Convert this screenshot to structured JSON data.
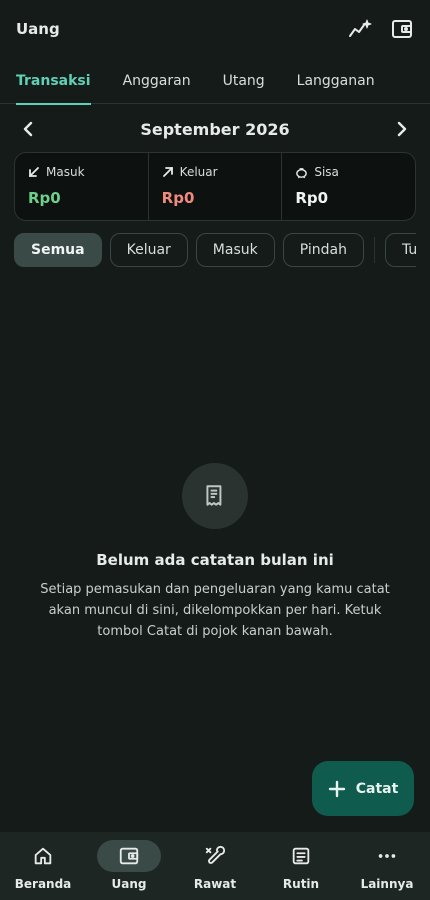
{
  "appbar": {
    "title": "Uang",
    "insights_icon": "sparkle-chart-icon",
    "wallet_icon": "wallet-icon"
  },
  "tabs": [
    {
      "label": "Transaksi",
      "active": true
    },
    {
      "label": "Anggaran",
      "active": false
    },
    {
      "label": "Utang",
      "active": false
    },
    {
      "label": "Langganan",
      "active": false
    }
  ],
  "period": {
    "month_label": "September 2026"
  },
  "summary": {
    "income": {
      "label": "Masuk",
      "value": "Rp0",
      "color": "#6fcf8a"
    },
    "expense": {
      "label": "Keluar",
      "value": "Rp0",
      "color": "#f08a7e"
    },
    "balance": {
      "label": "Sisa",
      "value": "Rp0",
      "color": "#f0f4f2"
    }
  },
  "filters": [
    {
      "label": "Semua",
      "active": true
    },
    {
      "label": "Keluar",
      "active": false
    },
    {
      "label": "Masuk",
      "active": false
    },
    {
      "label": "Pindah",
      "active": false
    },
    {
      "label": "Tunai",
      "active": false
    }
  ],
  "empty_state": {
    "title": "Belum ada catatan bulan ini",
    "description": "Setiap pemasukan dan pengeluaran yang kamu catat akan muncul di sini, dikelompokkan per hari. Ketuk tombol Catat di pojok kanan bawah."
  },
  "fab": {
    "label": "Catat"
  },
  "bottom_nav": [
    {
      "label": "Beranda",
      "icon": "home-icon",
      "active": false
    },
    {
      "label": "Uang",
      "icon": "wallet-icon",
      "active": true
    },
    {
      "label": "Rawat",
      "icon": "wrench-icon",
      "active": false
    },
    {
      "label": "Rutin",
      "icon": "list-icon",
      "active": false
    },
    {
      "label": "Lainnya",
      "icon": "more-icon",
      "active": false
    }
  ],
  "colors": {
    "accent": "#5fd0b4",
    "background": "#151b19",
    "fab": "#0f5b4e"
  }
}
